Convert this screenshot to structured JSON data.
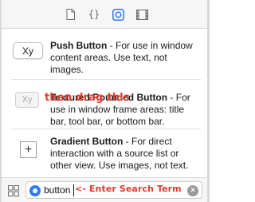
{
  "inspector_tabs": [
    {
      "icon": "file-icon"
    },
    {
      "icon": "braces-icon",
      "label": "{}"
    },
    {
      "icon": "object-library-icon",
      "selected": true
    },
    {
      "icon": "media-library-icon"
    }
  ],
  "library": {
    "items": [
      {
        "thumb_label": "Xy",
        "title": "Push Button",
        "description": " - For use in window content areas. Use text, not images."
      },
      {
        "thumb_label": "Xy",
        "title": "Textured Rounded Button",
        "description": " - For use in window frame areas: title bar, tool bar, or bottom bar."
      },
      {
        "thumb_label": "+",
        "title": "Gradient Button",
        "description": " - For direct interaction with a source list or other view. Use images, not text."
      }
    ]
  },
  "annotations": {
    "drag": "then drag this",
    "search": "<- Enter Search Term"
  },
  "search": {
    "value": "button",
    "clear_symbol": "×"
  },
  "colors": {
    "accent": "#2f7bf5",
    "annotation": "#e23a2a"
  }
}
